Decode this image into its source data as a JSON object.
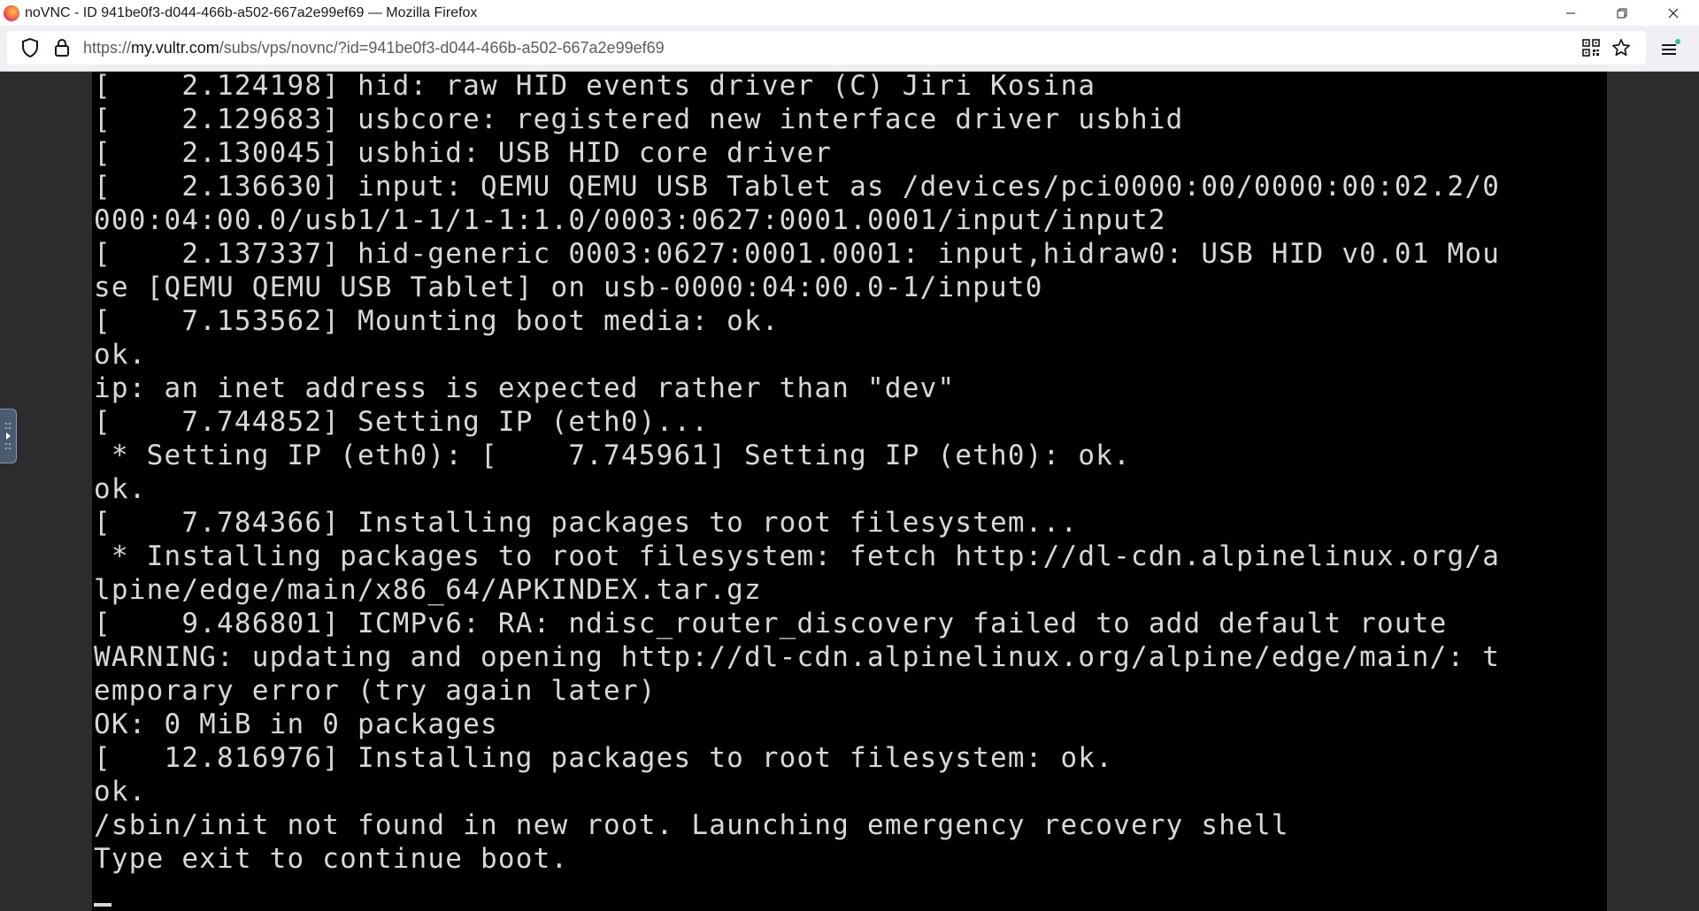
{
  "window": {
    "title": "noVNC - ID 941be0f3-d044-466b-a502-667a2e99ef69 — Mozilla Firefox",
    "minimize_glyph": "—",
    "restore_glyph": "❐",
    "close_glyph": "✕"
  },
  "urlbar": {
    "scheme": "https://",
    "host": "my.vultr.com",
    "path": "/subs/vps/novnc/?id=941be0f3-d044-466b-a502-667a2e99ef69"
  },
  "icons": {
    "tracking": "shield-icon",
    "security": "lock-icon",
    "qr": "qr-code-icon",
    "bookmark": "star-icon",
    "menu": "hamburger-menu-icon",
    "novnc_handle": "chevron-right-icon"
  },
  "colors": {
    "console_bg": "#000000",
    "console_fg": "#d8d8d8",
    "viewport_bg": "#2c2c2c",
    "menu_badge": "#2ac3a2"
  },
  "console": {
    "lines": [
      "[    2.124198] hid: raw HID events driver (C) Jiri Kosina",
      "[    2.129683] usbcore: registered new interface driver usbhid",
      "[    2.130045] usbhid: USB HID core driver",
      "[    2.136630] input: QEMU QEMU USB Tablet as /devices/pci0000:00/0000:00:02.2/0",
      "000:04:00.0/usb1/1-1/1-1:1.0/0003:0627:0001.0001/input/input2",
      "[    2.137337] hid-generic 0003:0627:0001.0001: input,hidraw0: USB HID v0.01 Mou",
      "se [QEMU QEMU USB Tablet] on usb-0000:04:00.0-1/input0",
      "[    7.153562] Mounting boot media: ok.",
      "ok.",
      "ip: an inet address is expected rather than \"dev\"",
      "[    7.744852] Setting IP (eth0)...",
      " * Setting IP (eth0): [    7.745961] Setting IP (eth0): ok.",
      "ok.",
      "[    7.784366] Installing packages to root filesystem...",
      " * Installing packages to root filesystem: fetch http://dl-cdn.alpinelinux.org/a",
      "lpine/edge/main/x86_64/APKINDEX.tar.gz",
      "[    9.486801] ICMPv6: RA: ndisc_router_discovery failed to add default route",
      "WARNING: updating and opening http://dl-cdn.alpinelinux.org/alpine/edge/main/: t",
      "emporary error (try again later)",
      "OK: 0 MiB in 0 packages",
      "[   12.816976] Installing packages to root filesystem: ok.",
      "ok.",
      "/sbin/init not found in new root. Launching emergency recovery shell",
      "Type exit to continue boot."
    ]
  }
}
